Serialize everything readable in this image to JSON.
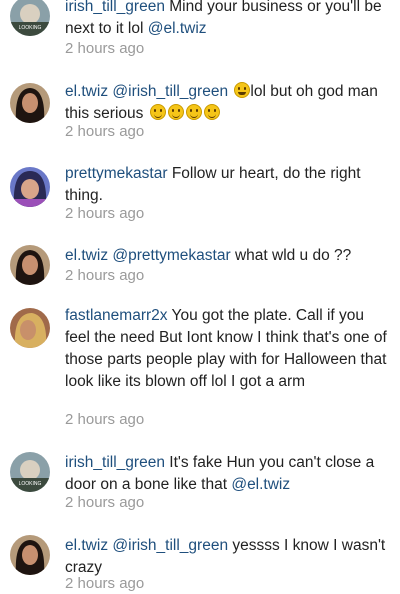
{
  "comments": [
    {
      "user": "irish_till_green",
      "parts": [
        " Mind your business or you'll be next to it lol ",
        "@el.twiz"
      ],
      "time": "2 hours ago",
      "avatar": "bunny-green"
    },
    {
      "user": "el.twiz",
      "mention": "@irish_till_green",
      "text": "lol but oh god man this serious",
      "time": "2 hours ago",
      "avatar": "woman-dark"
    },
    {
      "user": "prettymekastar",
      "text": " Follow ur heart,  do the right thing.",
      "time": "2 hours ago",
      "avatar": "purple-character"
    },
    {
      "user": "el.twiz",
      "mention": "@prettymekastar",
      "text": " what wld u do ??",
      "time": "2 hours ago",
      "avatar": "woman-dark"
    },
    {
      "user": "fastlanemarr2x",
      "text": " You got the plate. Call if you feel the need But Iont know I think that's one of those parts people play with for Halloween that look like its blown off lol I got a arm",
      "time": "2 hours ago",
      "avatar": "woman-blonde"
    },
    {
      "user": "irish_till_green",
      "text": " It's fake Hun you can't close a door on a bone like that ",
      "mention2": "@el.twiz",
      "time": "2 hours ago",
      "avatar": "bunny-green"
    },
    {
      "user": "el.twiz",
      "mention": "@irish_till_green",
      "text": " yessss I know I wasn't crazy",
      "time": "2 hours ago",
      "avatar": "woman-dark"
    }
  ],
  "colors": {
    "username": "#1f4f7d",
    "text": "#222222",
    "timestamp": "#9a9a9a"
  }
}
